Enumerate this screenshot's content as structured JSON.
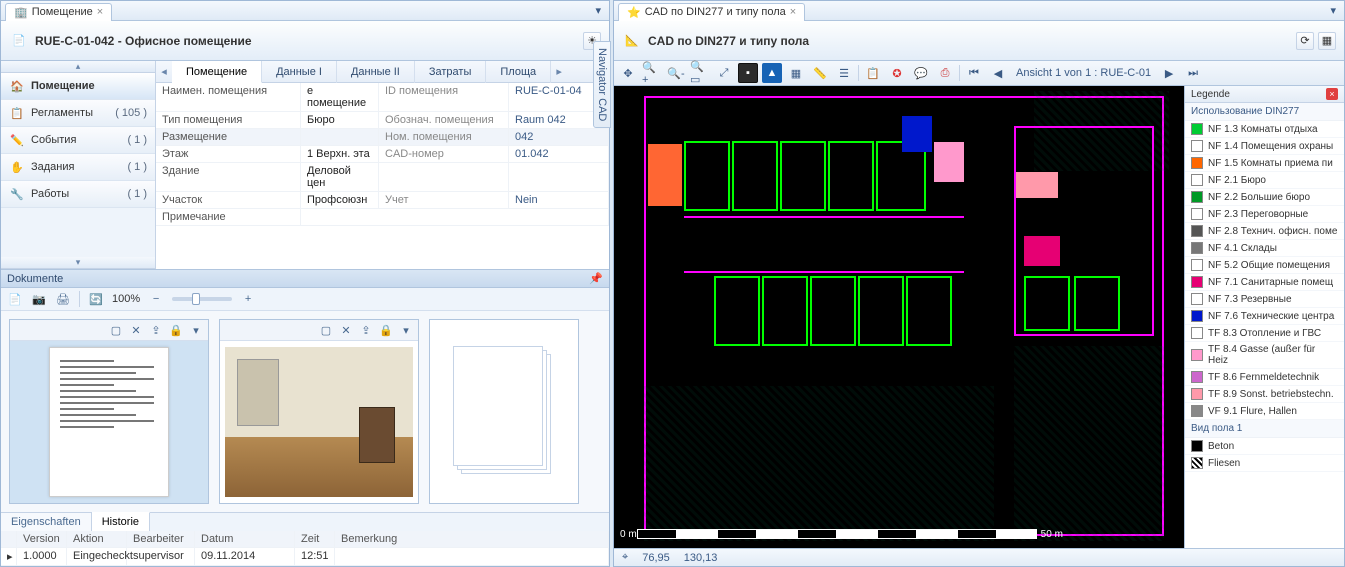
{
  "left": {
    "tab": {
      "icon": "building-icon",
      "label": "Помещение"
    },
    "title": "RUE-C-01-042 - Офисное помещение",
    "verticalTab": "Navigator CAD",
    "sidebar": {
      "items": [
        {
          "icon": "room",
          "label": "Помещение",
          "count": ""
        },
        {
          "icon": "clipboard",
          "label": "Регламенты",
          "count": "( 105 )"
        },
        {
          "icon": "pencil",
          "label": "События",
          "count": "( 1 )"
        },
        {
          "icon": "hand",
          "label": "Задания",
          "count": "( 1 )"
        },
        {
          "icon": "wrench",
          "label": "Работы",
          "count": "( 1 )"
        }
      ]
    },
    "detailTabs": [
      "Помещение",
      "Данные I",
      "Данные II",
      "Затраты",
      "Площа"
    ],
    "props": [
      {
        "l": "Наимен. помещения",
        "v": "е помещение",
        "l2": "ID помещения",
        "v2": "RUE-C-01-04"
      },
      {
        "l": "Тип помещения",
        "v": "Бюро",
        "l2": "Обознач. помещения",
        "v2": "Raum 042"
      },
      {
        "section": "Размещение",
        "l2": "Ном. помещения",
        "v2": "042"
      },
      {
        "l": "Этаж",
        "v": "1 Верхн. эта",
        "l2": "CAD-номер",
        "v2": "01.042"
      },
      {
        "l": "Здание",
        "v": "Деловой цен"
      },
      {
        "l": "Участок",
        "v": "Профсоюзн",
        "l2": "Учет",
        "v2": "Nein"
      },
      {
        "l": "Примечание",
        "v": ""
      }
    ],
    "documents": {
      "header": "Dokumente",
      "zoom": "100%",
      "miniTabs": [
        "Eigenschaften",
        "Historie"
      ],
      "history": {
        "cols": [
          "",
          "Version",
          "Aktion",
          "Bearbeiter",
          "Datum",
          "Zeit",
          "Bemerkung"
        ],
        "row": {
          "version": "1.0000",
          "aktion": "Eingecheckt",
          "user": "supervisor",
          "date": "09.11.2014",
          "time": "12:51",
          "note": ""
        }
      }
    }
  },
  "right": {
    "tab": {
      "label": "CAD по DIN277 и типу пола"
    },
    "title": "CAD по DIN277 и типу пола",
    "viewLabel": "Ansicht 1 von 1 : RUE-C-01",
    "scale": {
      "left": "0 m",
      "right": "50 m"
    },
    "status": {
      "x": "76,95",
      "y": "130,13"
    },
    "legend": {
      "title": "Legende",
      "section1": "Использование DIN277",
      "items": [
        {
          "c": "#00cc33",
          "t": "NF 1.3 Комнаты отдыха"
        },
        {
          "c": "#ffffff",
          "t": "NF 1.4 Помещения охраны"
        },
        {
          "c": "#ff6600",
          "t": "NF 1.5 Комнаты приема пи"
        },
        {
          "c": "#ffffff",
          "t": "NF 2.1 Бюро"
        },
        {
          "c": "#009926",
          "t": "NF 2.2 Большие бюро"
        },
        {
          "c": "#ffffff",
          "t": "NF 2.3 Переговорные"
        },
        {
          "c": "#555555",
          "t": "NF 2.8 Технич. офисн. поме"
        },
        {
          "c": "#777777",
          "t": "NF 4.1 Склады"
        },
        {
          "c": "#ffffff",
          "t": "NF 5.2 Общие помещения"
        },
        {
          "c": "#e60073",
          "t": "NF 7.1 Санитарные помещ"
        },
        {
          "c": "#ffffff",
          "t": "NF 7.3 Резервные"
        },
        {
          "c": "#0018cc",
          "t": "NF 7.6 Технические центра"
        },
        {
          "c": "#ffffff",
          "t": "TF 8.3 Отопление и ГВС"
        },
        {
          "c": "#ff99cc",
          "t": "TF 8.4 Gasse (außer für Heiz"
        },
        {
          "c": "#cc66cc",
          "t": "TF 8.6 Fernmeldetechnik"
        },
        {
          "c": "#ff99aa",
          "t": "TF 8.9 Sonst. betriebstechn."
        },
        {
          "c": "#888888",
          "t": "VF 9.1 Flure,  Hallen"
        }
      ],
      "section2": "Вид пола 1",
      "items2": [
        {
          "c": "#000000",
          "t": "Beton"
        },
        {
          "hatch": true,
          "t": "Fliesen"
        }
      ]
    }
  }
}
